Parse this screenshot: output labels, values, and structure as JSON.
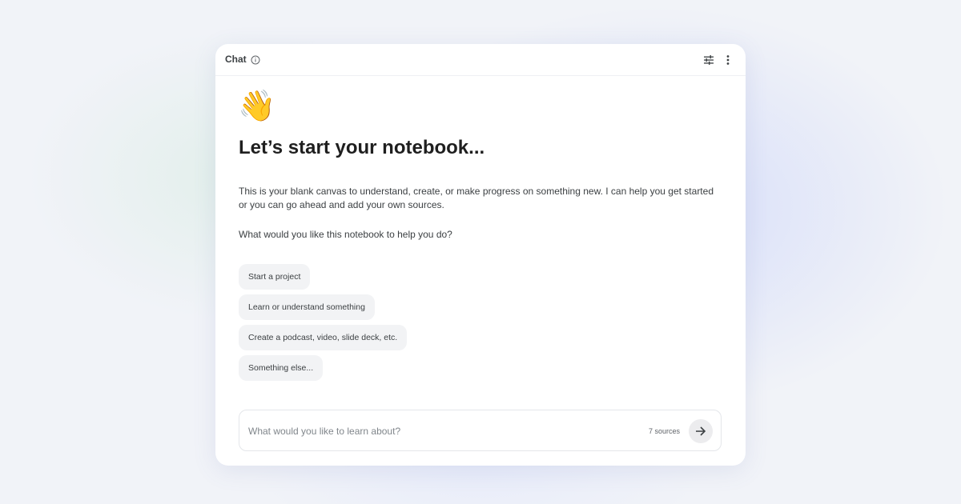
{
  "header": {
    "title": "Chat",
    "icons": [
      "info-icon",
      "tune-icon",
      "more-vert-icon"
    ]
  },
  "hero": {
    "emoji": "👋",
    "title": "Let’s start your notebook..."
  },
  "intro": {
    "text": "This is your blank canvas to understand, create, or make progress on something new. I can help you get started or you can go ahead and add your own sources.",
    "question": "What would you like this notebook to help you do?"
  },
  "suggestions": [
    {
      "label": "Start a project"
    },
    {
      "label": "Learn or understand something"
    },
    {
      "label": "Create a podcast, video, slide deck, etc."
    },
    {
      "label": "Something else..."
    }
  ],
  "chat_input": {
    "placeholder": "What would you like to learn about?",
    "value": "",
    "sources_count": "7 sources",
    "send_icon": "arrow-forward-icon"
  },
  "colors": {
    "page_background": "#f1f3f8",
    "panel_background": "#ffffff",
    "chip_background": "#f2f3f5",
    "text_primary": "#1f1f1f",
    "text_secondary": "#3c4043"
  }
}
